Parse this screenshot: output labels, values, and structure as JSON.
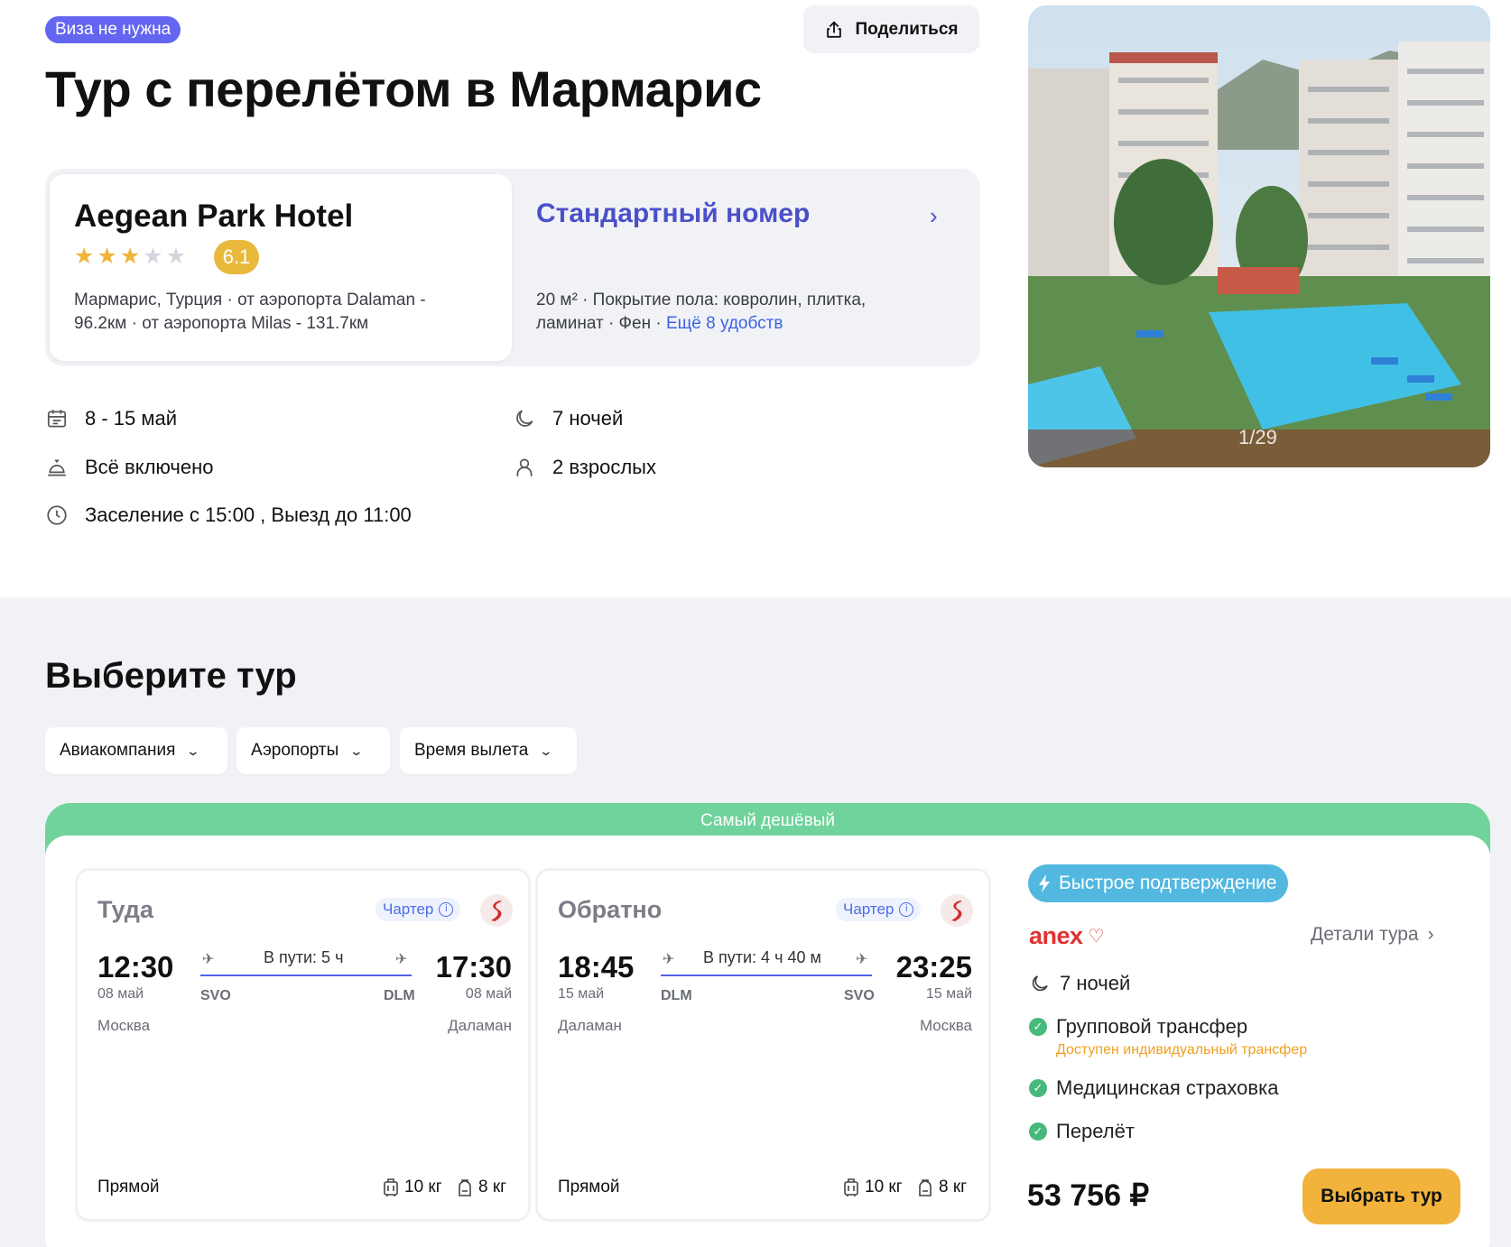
{
  "header": {
    "visa_badge": "Виза не нужна",
    "share_label": "Поделиться",
    "title": "Тур с перелётом в Мармарис"
  },
  "hotel": {
    "name": "Aegean Park Hotel",
    "stars": 3,
    "max_stars": 5,
    "rating": "6.1",
    "location_line1": "Мармарис, Турция · от аэропорта Dalaman -",
    "location_line2": "96.2км · от аэропорта Milas - 131.7км"
  },
  "room": {
    "title": "Стандартный номер",
    "desc_line1": "20 м² · Покрытие пола: ковролин, плитка,",
    "desc_line2_prefix": "ламинат · Фен · ",
    "more_link": "Ещё 8 удобств"
  },
  "trip_info": {
    "dates": "8 - 15 май",
    "nights": "7 ночей",
    "meal": "Всё включено",
    "guests": "2 взрослых",
    "checkin": "Заселение с 15:00 , Выезд до 11:00"
  },
  "gallery": {
    "counter": "1/29"
  },
  "choose_section": {
    "title": "Выберите тур",
    "filters": [
      "Авиакомпания",
      "Аэропорты",
      "Время вылета"
    ]
  },
  "offer": {
    "banner": "Самый дешёвый",
    "outbound": {
      "title": "Туда",
      "charter": "Чартер",
      "dep_time": "12:30",
      "dep_date": "08 май",
      "dep_city": "Москва",
      "dep_code": "SVO",
      "duration": "В пути: 5 ч",
      "arr_time": "17:30",
      "arr_date": "08 май",
      "arr_city": "Даламан",
      "arr_code": "DLM",
      "type": "Прямой",
      "baggage": "10 кг",
      "hand": "8 кг"
    },
    "return": {
      "title": "Обратно",
      "charter": "Чартер",
      "dep_time": "18:45",
      "dep_date": "15 май",
      "dep_city": "Даламан",
      "dep_code": "DLM",
      "duration": "В пути: 4 ч 40 м",
      "arr_time": "23:25",
      "arr_date": "15 май",
      "arr_city": "Москва",
      "arr_code": "SVO",
      "type": "Прямой",
      "baggage": "10 кг",
      "hand": "8 кг"
    },
    "fast_confirm": "Быстрое подтверждение",
    "operator": "anex",
    "details_link": "Детали тура",
    "nights": "7 ночей",
    "included": {
      "transfer": "Групповой трансфер",
      "transfer_note": "Доступен индивидуальный трансфер",
      "insurance": "Медицинская страховка",
      "flight": "Перелёт"
    },
    "price": "53 756 ₽",
    "choose_label": "Выбрать тур"
  },
  "colors": {
    "accent_blue": "#4b50c8",
    "badge_purple": "#6466f1",
    "rating_yellow": "#e9b93c",
    "banner_green": "#6fd39b",
    "button_orange": "#f2b33d"
  }
}
